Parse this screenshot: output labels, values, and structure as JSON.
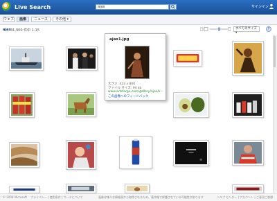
{
  "header": {
    "brand": "Live Search",
    "query": "ajax",
    "signin_label": "サインイン"
  },
  "tabs": [
    {
      "label": "ウェブ"
    },
    {
      "label": "画像"
    },
    {
      "label": "ニュース"
    },
    {
      "label": "その他 ▾"
    }
  ],
  "results": {
    "query": "ajax",
    "count": "41,900 件中 1-15",
    "size_filter": "すべてのサイズ ▾"
  },
  "popup": {
    "title": "ajax1.jpg",
    "dimensions": "大きさ: 423 x 800",
    "filesize": "ファイル サイズ: 94 kb",
    "url": "www.artsforge.com/gallery/ajax/k...",
    "feedback": "この画像へのフィードバック"
  },
  "footer": {
    "copyright": "© 2008 Microsoft",
    "links": "プライバシー | 使用条件 | サーチについて",
    "notice": "画像は様々な情報源から取得されるため、著作権で保護されている可能性があります",
    "right": "ヘルプ センター | アカウント | ご意見ご感想"
  }
}
